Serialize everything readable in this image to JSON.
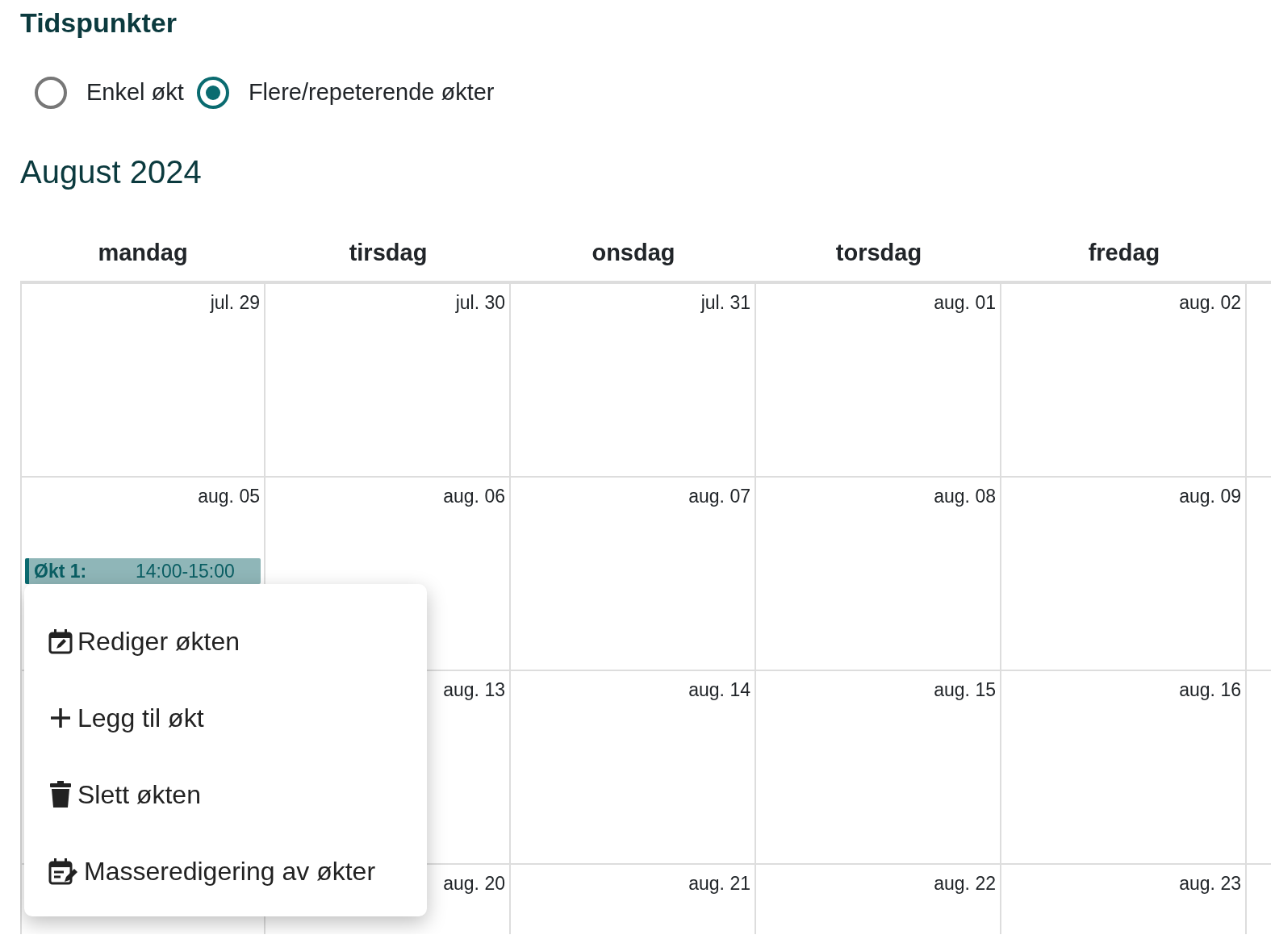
{
  "section_title": "Tidspunkter",
  "session_modes": [
    {
      "label": "Enkel økt",
      "selected": false
    },
    {
      "label": "Flere/repeterende økter",
      "selected": true
    }
  ],
  "month_title": "August 2024",
  "weekdays": [
    "mandag",
    "tirsdag",
    "onsdag",
    "torsdag",
    "fredag"
  ],
  "weeks": [
    {
      "days": [
        {
          "date": "jul. 29"
        },
        {
          "date": "jul. 30"
        },
        {
          "date": "jul. 31"
        },
        {
          "date": "aug. 01"
        },
        {
          "date": "aug. 02"
        }
      ]
    },
    {
      "days": [
        {
          "date": "aug. 05",
          "events": [
            {
              "label": "Økt 1:",
              "time": "14:00-15:00"
            }
          ]
        },
        {
          "date": "aug. 06"
        },
        {
          "date": "aug. 07"
        },
        {
          "date": "aug. 08"
        },
        {
          "date": "aug. 09"
        }
      ]
    },
    {
      "days": [
        {
          "date": "aug. 13"
        },
        {
          "date": "aug. 14"
        },
        {
          "date": "aug. 15"
        },
        {
          "date": "aug. 16"
        }
      ]
    },
    {
      "days": [
        {
          "date": "aug. 20"
        },
        {
          "date": "aug. 21"
        },
        {
          "date": "aug. 22"
        },
        {
          "date": "aug. 23"
        }
      ]
    }
  ],
  "context_menu": [
    {
      "kind": "edit",
      "label": "Rediger økten"
    },
    {
      "kind": "add",
      "label": "Legg til økt"
    },
    {
      "kind": "delete",
      "label": "Slett økten"
    },
    {
      "kind": "bulk",
      "label": "Masseredigering av økter"
    }
  ]
}
